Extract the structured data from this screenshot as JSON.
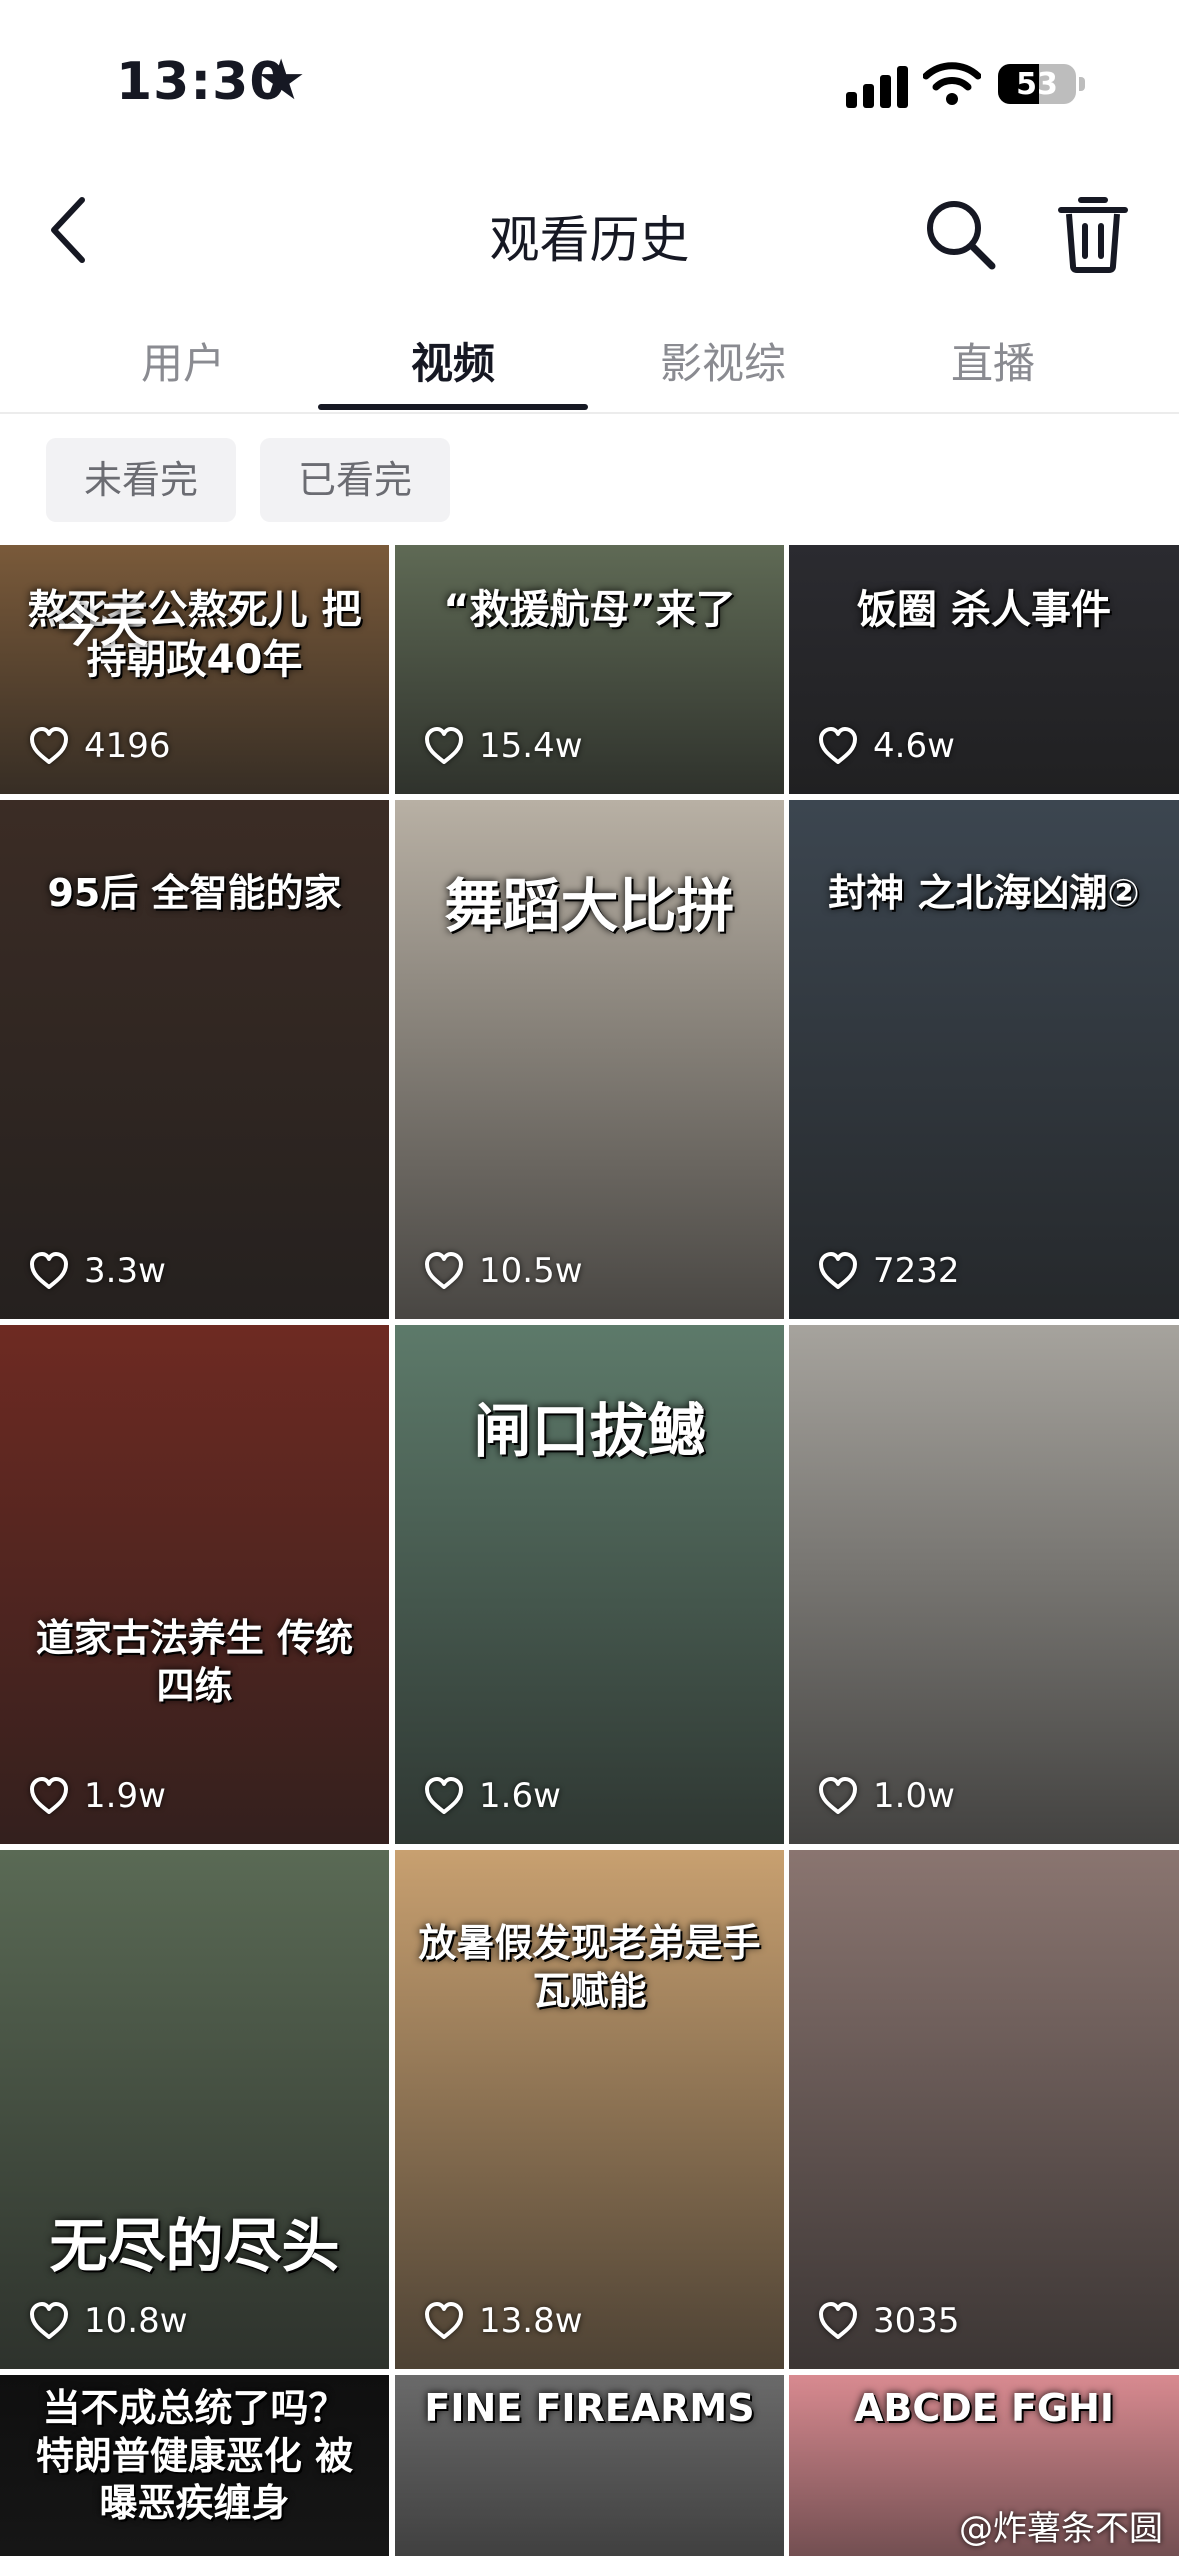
{
  "status_bar": {
    "time": "13:30",
    "battery": "53",
    "battery_level": 0.53
  },
  "nav": {
    "title": "观看历史"
  },
  "tabs": [
    {
      "label": "用户"
    },
    {
      "label": "视频"
    },
    {
      "label": "影视综"
    },
    {
      "label": "直播"
    }
  ],
  "active_tab": "视频",
  "filters": [
    {
      "label": "未看完"
    },
    {
      "label": "已看完"
    }
  ],
  "section_label": "今天",
  "videos": [
    {
      "caption": "熬死老公熬死儿 把持朝政40年",
      "likes": "4196",
      "bg": "#7a5a3a"
    },
    {
      "caption": "“救援航母”来了",
      "likes": "15.4w",
      "bg": "#5f6a55"
    },
    {
      "caption": "饭圈 杀人事件",
      "likes": "4.6w",
      "bg": "#2b2b30"
    },
    {
      "caption": "95后 全智能的家",
      "likes": "3.3w",
      "bg": "#3b2c25"
    },
    {
      "caption": "舞蹈大比拼",
      "likes": "10.5w",
      "bg": "#b8b0a4"
    },
    {
      "caption": "封神 之北海凶潮②",
      "likes": "7232",
      "bg": "#3c4650"
    },
    {
      "caption": "道家古法养生 传统四练",
      "likes": "1.9w",
      "bg": "#6e2a22"
    },
    {
      "caption": "闸口拔鳡",
      "likes": "1.6w",
      "bg": "#5d7a6a"
    },
    {
      "caption": "",
      "likes": "1.0w",
      "bg": "#a6a39d"
    },
    {
      "caption": "无尽的尽头",
      "likes": "10.8w",
      "bg": "#5a6a55"
    },
    {
      "caption": "放暑假发现老弟是手瓦赋能",
      "likes": "13.8w",
      "bg": "#c8a070"
    },
    {
      "caption": "",
      "likes": "3035",
      "bg": "#8a7570"
    },
    {
      "caption": "当不成总统了吗？ 特朗普健康恶化 被曝恶疾缠身",
      "likes": "",
      "bg": "#0f0f0f"
    },
    {
      "caption": "FINE FIREARMS",
      "likes": "",
      "bg": "#6a6a6a"
    },
    {
      "caption": "ABCDE FGHI",
      "likes": "",
      "bg": "#d88a90"
    }
  ],
  "watermark": "@炸薯条不圆"
}
